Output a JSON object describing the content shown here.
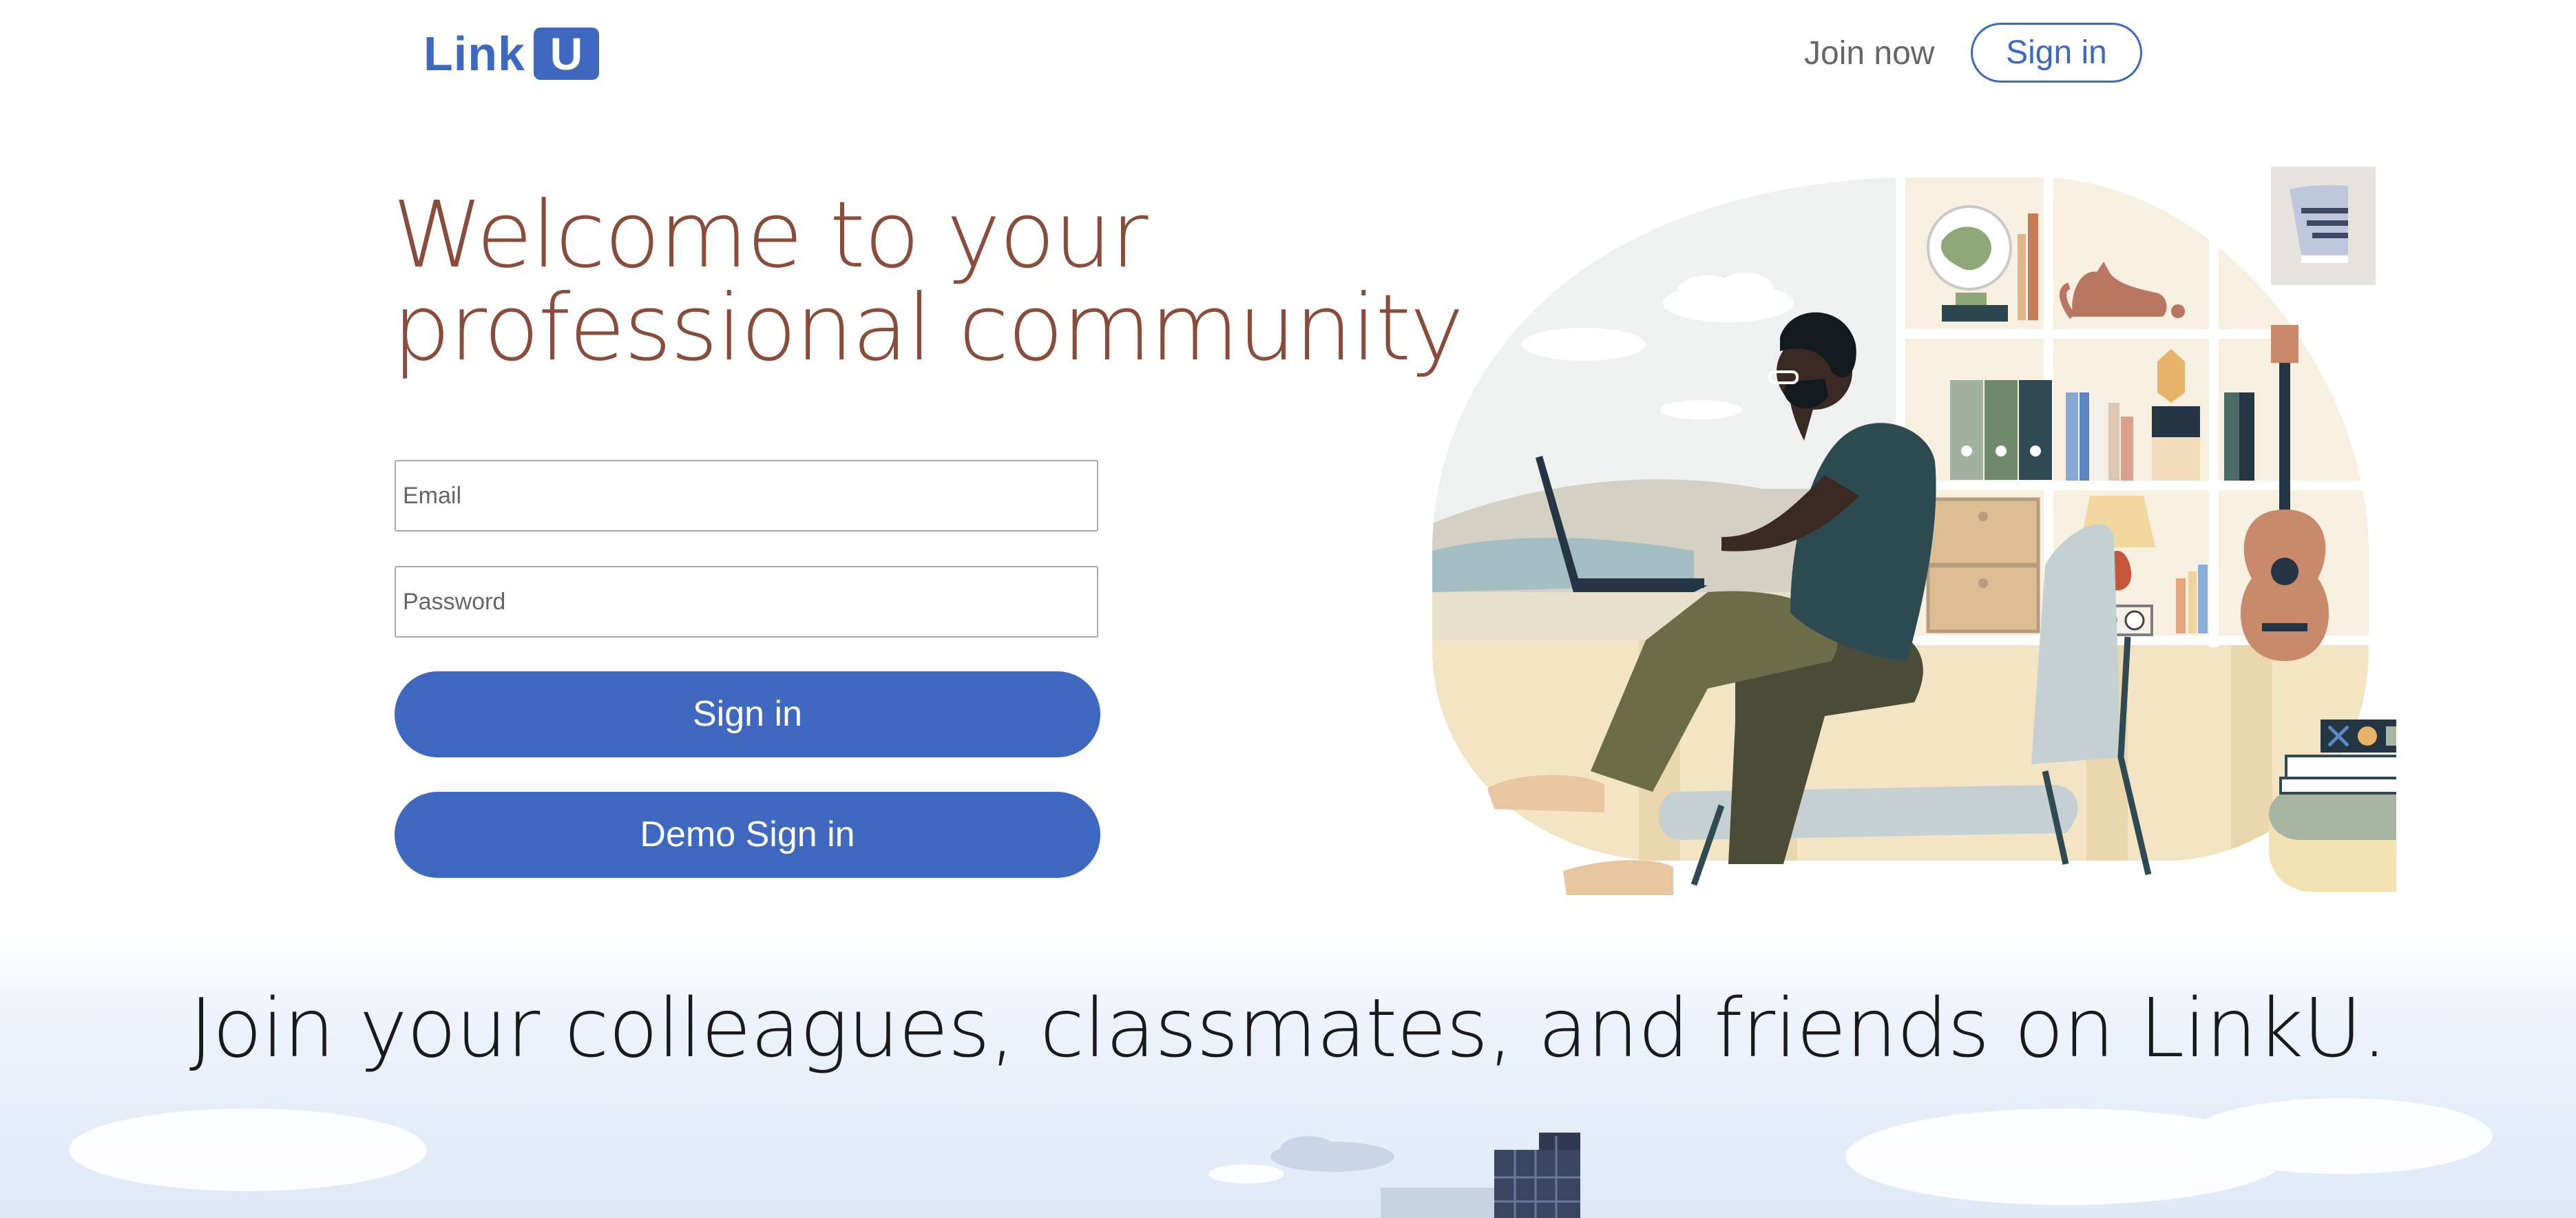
{
  "nav": {
    "logo_text": "Link",
    "logo_box_text": "U",
    "join_now_label": "Join now",
    "sign_in_label": "Sign in"
  },
  "hero": {
    "title_line1": "Welcome to your",
    "title_line2": "professional community",
    "email_placeholder": "Email",
    "password_placeholder": "Password",
    "sign_in_button": "Sign in",
    "demo_sign_in_button": "Demo Sign in"
  },
  "footer_band": {
    "tagline": "Join your colleagues, classmates, and friends on LinkU."
  },
  "colors": {
    "brand": "#3f68c0",
    "headline": "#8a4d3b",
    "muted_text": "#666666",
    "band_bg": "#dfe9f7"
  }
}
